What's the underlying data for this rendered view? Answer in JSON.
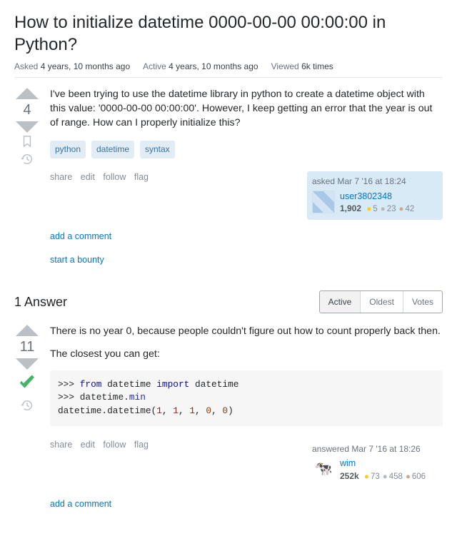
{
  "title": "How to initialize datetime 0000-00-00 00:00:00 in Python?",
  "meta": {
    "asked_label": "Asked",
    "asked_val": "4 years, 10 months ago",
    "active_label": "Active",
    "active_val": "4 years, 10 months ago",
    "viewed_label": "Viewed",
    "viewed_val": "6k times"
  },
  "question": {
    "score": "4",
    "body": "I've been trying to use the datetime library in python to create a datetime object with this value: '0000-00-00 00:00:00'. However, I keep getting an error that the year is out of range. How can I properly initialize this?",
    "tags": [
      "python",
      "datetime",
      "syntax"
    ],
    "actions": {
      "share": "share",
      "edit": "edit",
      "follow": "follow",
      "flag": "flag"
    },
    "usercard": {
      "time": "asked Mar 7 '16 at 18:24",
      "name": "user3802348",
      "rep": "1,902",
      "gold": "5",
      "silver": "23",
      "bronze": "42"
    },
    "add_comment": "add a comment",
    "start_bounty": "start a bounty"
  },
  "answers_header": {
    "count_text": "1 Answer",
    "tabs": {
      "active": "Active",
      "oldest": "Oldest",
      "votes": "Votes"
    }
  },
  "answer": {
    "score": "11",
    "p1": "There is no year 0, because people couldn't figure out how to count properly back then.",
    "p2": "The closest you can get:",
    "code": {
      "prompt": ">>> ",
      "from": "from",
      "mod1": "datetime",
      "import": "import",
      "mod2": "datetime",
      "line2_pre": "datetime.",
      "min": "min",
      "line3_pre": "datetime.datetime(",
      "n1": "1",
      "n2": "1",
      "n3": "1",
      "z1": "0",
      "z2": "0",
      "close": ")"
    },
    "actions": {
      "share": "share",
      "edit": "edit",
      "follow": "follow",
      "flag": "flag"
    },
    "usercard": {
      "time": "answered Mar 7 '16 at 18:26",
      "name": "wim",
      "rep": "252k",
      "gold": "73",
      "silver": "458",
      "bronze": "606"
    },
    "add_comment": "add a comment"
  }
}
